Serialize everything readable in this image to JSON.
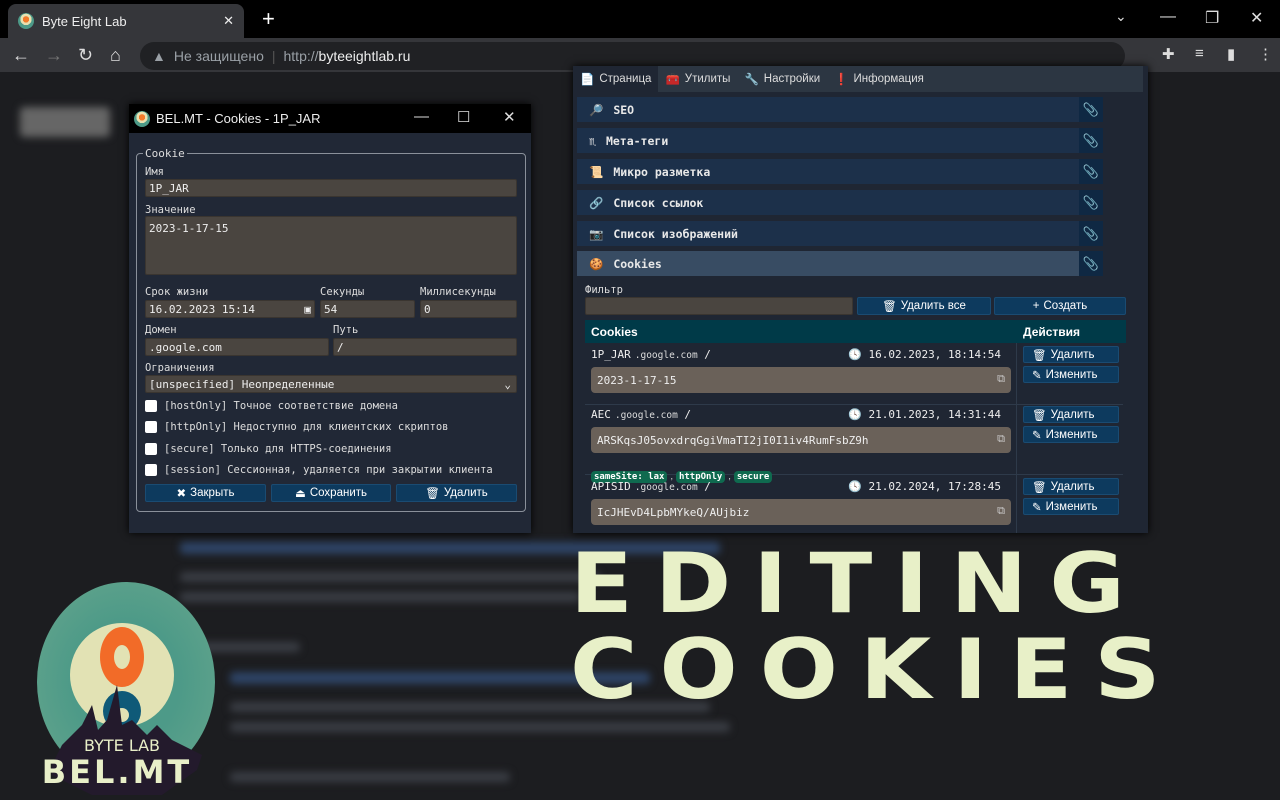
{
  "browser": {
    "tab_title": "Byte Eight Lab",
    "new_tab": "+",
    "security": "Не защищено",
    "url_scheme": "http://",
    "url_host": "byteeightlab.ru"
  },
  "dialog": {
    "title": "BEL.MT - Cookies - 1P_JAR",
    "legend": "Cookie",
    "name_label": "Имя",
    "name_value": "1P_JAR",
    "value_label": "Значение",
    "value_value": "2023-1-17-15",
    "expires_label": "Срок жизни",
    "expires_value": "16.02.2023 15:14",
    "seconds_label": "Секунды",
    "seconds_value": "54",
    "ms_label": "Миллисекунды",
    "ms_value": "0",
    "domain_label": "Домен",
    "domain_value": ".google.com",
    "path_label": "Путь",
    "path_value": "/",
    "restrictions_label": "Ограничения",
    "restrictions_value": "[unspecified] Неопределенные",
    "checkboxes": [
      {
        "label": "[hostOnly] Точное соответствие домена",
        "checked": false
      },
      {
        "label": "[httpOnly] Недоступно для клиентских скриптов",
        "checked": false
      },
      {
        "label": "[secure] Только для HTTPS-соединения",
        "checked": false
      },
      {
        "label": "[session] Сессионная, удаляется при закрытии клиента",
        "checked": false
      }
    ],
    "close_label": "Закрыть",
    "save_label": "Сохранить",
    "delete_label": "Удалить"
  },
  "extension": {
    "tabs": [
      {
        "icon": "📄",
        "label": "Страница"
      },
      {
        "icon": "🧰",
        "label": "Утилиты"
      },
      {
        "icon": "🔧",
        "label": "Настройки"
      },
      {
        "icon": "❗",
        "label": "Информация"
      }
    ],
    "sections": [
      {
        "icon": "🔎",
        "label": "SEO"
      },
      {
        "icon": "♏",
        "label": "Мета-теги"
      },
      {
        "icon": "📜",
        "label": "Микро разметка"
      },
      {
        "icon": "🔗",
        "label": "Список ссылок"
      },
      {
        "icon": "📷",
        "label": "Список изображений"
      },
      {
        "icon": "🍪",
        "label": "Cookies"
      }
    ],
    "filter_label": "Фильтр",
    "filter_value": "",
    "delete_all_label": "Удалить все",
    "create_label": "Создать",
    "col_cookies": "Cookies",
    "col_actions": "Действия",
    "delete_label": "Удалить",
    "edit_label": "Изменить",
    "cookies": [
      {
        "name": "1P_JAR",
        "domain": ".google.com",
        "path": "/",
        "expires": "16.02.2023, 18:14:54",
        "value": "2023-1-17-15",
        "flags": []
      },
      {
        "name": "AEC",
        "domain": ".google.com",
        "path": "/",
        "expires": "21.01.2023, 14:31:44",
        "value": "ARSKqsJ05ovxdrqGgiVmaTI2jI0I1iv4RumFsbZ9h",
        "flags": [
          "sameSite: lax",
          "httpOnly",
          "secure"
        ]
      },
      {
        "name": "APISID",
        "domain": ".google.com",
        "path": "/",
        "expires": "21.02.2024, 17:28:45",
        "value": "IcJHEvD4LpbMYkeQ/AUjbiz",
        "flags": []
      }
    ]
  },
  "headline": {
    "line1": "EDITING",
    "line2": "COOKIES"
  },
  "logo": {
    "top": "BYTE LAB",
    "bottom": "BEL.MT"
  },
  "colors": {
    "accent": "#0d3a5e",
    "headline": "#e8f0c8",
    "badge": "#0f6a4f"
  }
}
